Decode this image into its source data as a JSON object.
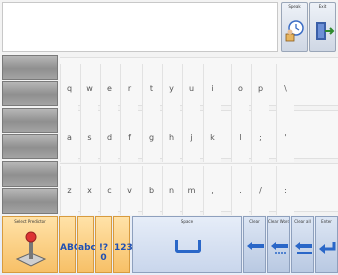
{
  "top_buttons": [
    {
      "label": "Speak"
    },
    {
      "label": "Exit"
    }
  ],
  "keyboard": {
    "rows": [
      [
        "q",
        "w",
        "e",
        "r",
        "t",
        "y",
        "u",
        "i",
        "o",
        "p",
        "\\"
      ],
      [
        "a",
        "s",
        "d",
        "f",
        "g",
        "h",
        "j",
        "k",
        "l",
        ";",
        "'"
      ],
      [
        "z",
        "x",
        "c",
        "v",
        "b",
        "n",
        "m",
        ",",
        ".",
        "/",
        ":"
      ]
    ]
  },
  "bottom_bar": {
    "select_predictor_label": "Select Predictor",
    "case_buttons": [
      {
        "text": "ABC"
      },
      {
        "text": "abc"
      },
      {
        "text": "!?0"
      },
      {
        "text": "123"
      }
    ],
    "space_label": "Space",
    "delete_buttons": [
      {
        "label": "Clear"
      },
      {
        "label": "Clear Word"
      },
      {
        "label": "Clear all"
      },
      {
        "label": "Enter"
      }
    ]
  },
  "colors": {
    "accent_orange": "#f7c067",
    "accent_blue": "#2a67c8",
    "side_gray": "#9a9a9a"
  }
}
